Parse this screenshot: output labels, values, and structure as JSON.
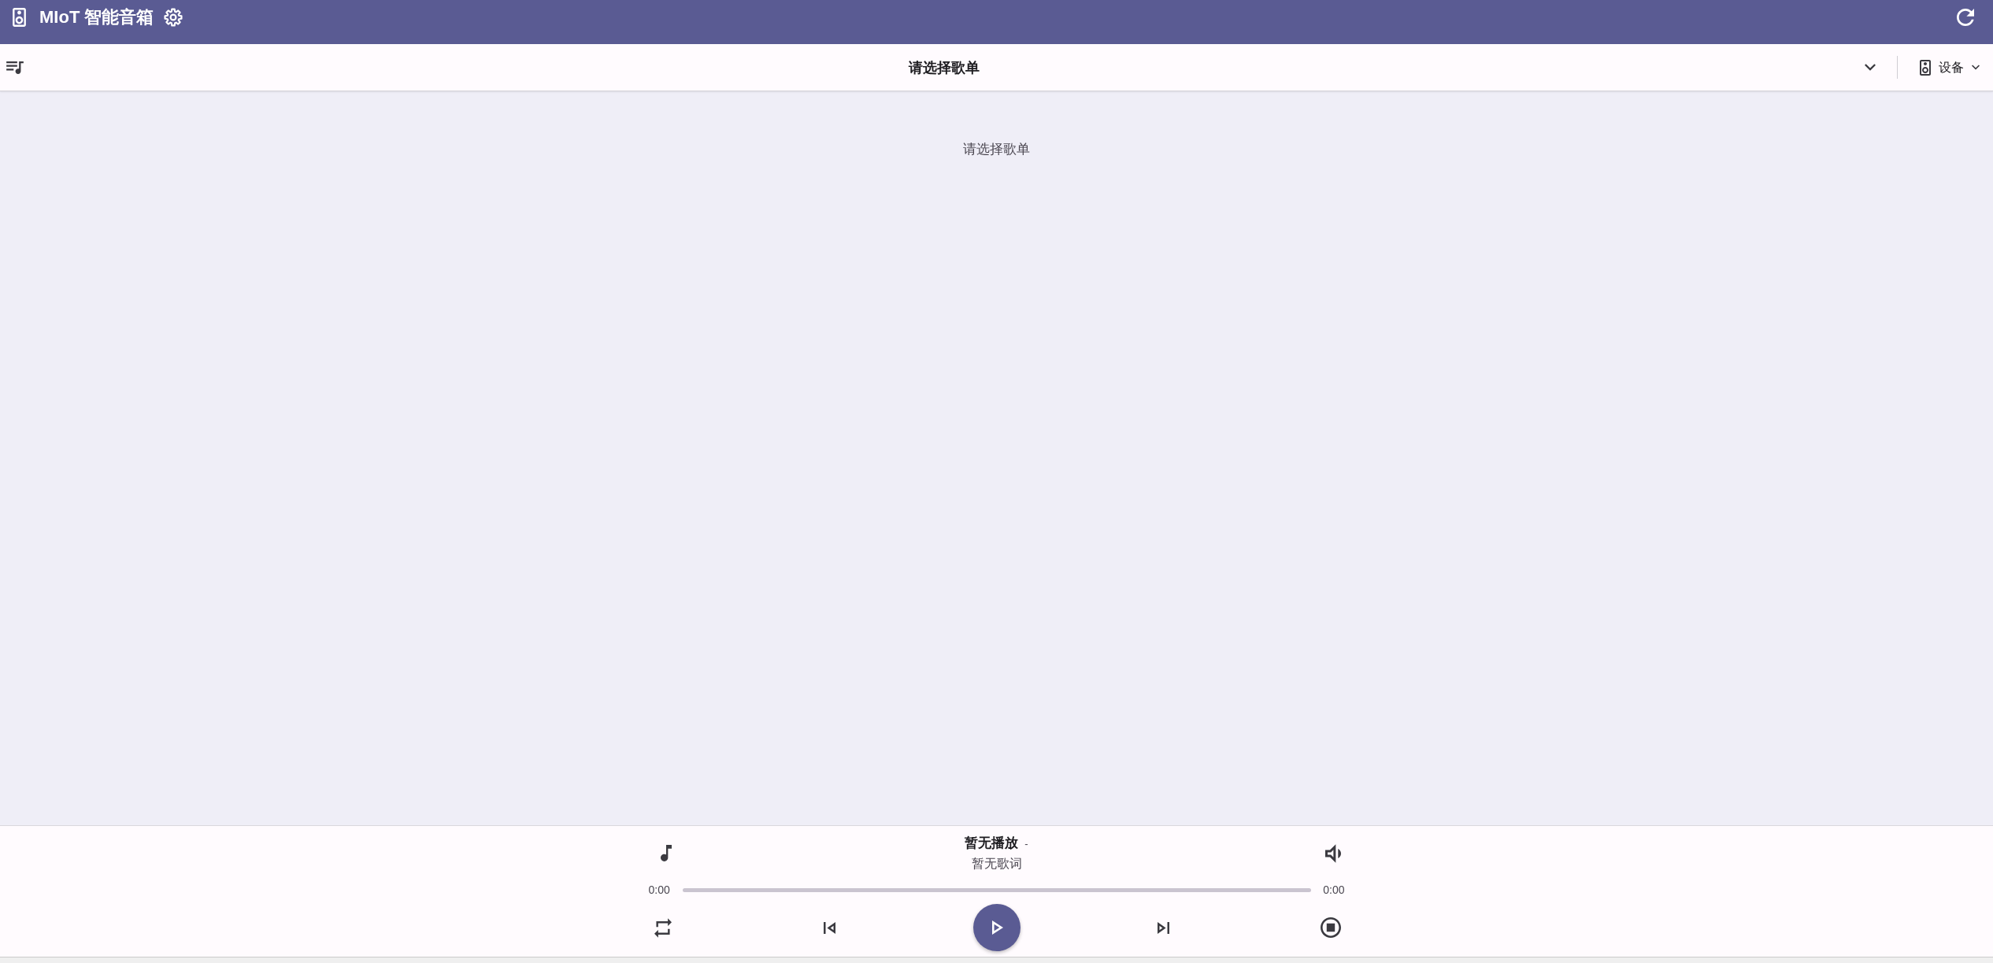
{
  "app_bar": {
    "title": "MIoT 智能音箱"
  },
  "playlist_bar": {
    "title": "请选择歌单",
    "device_label": "设备"
  },
  "content": {
    "message": "请选择歌单"
  },
  "player": {
    "title": "暂无播放",
    "artist": "-",
    "lyrics": "暂无歌词",
    "elapsed": "0:00",
    "duration": "0:00",
    "playing": false
  }
}
